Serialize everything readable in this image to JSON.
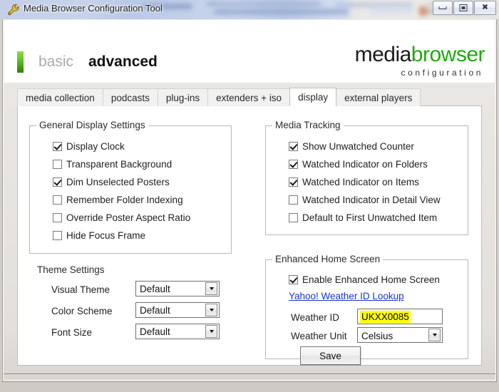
{
  "window": {
    "title": "Media Browser Configuration Tool",
    "icon": "wrench-icon",
    "buttons": {
      "minimize": "Minimize",
      "maximize": "Restore",
      "close": "Close"
    }
  },
  "header": {
    "basic_label": "basic",
    "advanced_label": "advanced",
    "logo_part1": "media",
    "logo_part2": "browser",
    "logo_subtitle": "configuration",
    "accent_green": "#22a613",
    "accent_bar_green": "#5cb81f"
  },
  "tabs": [
    {
      "label": "media collection",
      "active": false
    },
    {
      "label": "podcasts",
      "active": false
    },
    {
      "label": "plug-ins",
      "active": false
    },
    {
      "label": "extenders + iso",
      "active": false
    },
    {
      "label": "display",
      "active": true
    },
    {
      "label": "external players",
      "active": false
    }
  ],
  "general_display_settings": {
    "title": "General Display Settings",
    "checkboxes": [
      {
        "label": "Display Clock",
        "checked": true
      },
      {
        "label": "Transparent Background",
        "checked": false
      },
      {
        "label": "Dim Unselected Posters",
        "checked": true
      },
      {
        "label": "Remember Folder Indexing",
        "checked": false
      },
      {
        "label": "Override Poster Aspect Ratio",
        "checked": false
      },
      {
        "label": "Hide Focus Frame",
        "checked": false
      }
    ]
  },
  "media_tracking": {
    "title": "Media Tracking",
    "checkboxes": [
      {
        "label": "Show Unwatched Counter",
        "checked": true
      },
      {
        "label": "Watched Indicator on Folders",
        "checked": true
      },
      {
        "label": "Watched Indicator on Items",
        "checked": true
      },
      {
        "label": "Watched Indicator in Detail View",
        "checked": false
      },
      {
        "label": "Default to First Unwatched Item",
        "checked": false
      }
    ]
  },
  "theme_settings": {
    "title": "Theme Settings",
    "fields": [
      {
        "label": "Visual Theme",
        "value": "Default"
      },
      {
        "label": "Color Scheme",
        "value": "Default"
      },
      {
        "label": "Font Size",
        "value": "Default"
      }
    ]
  },
  "enhanced_home_screen": {
    "title": "Enhanced Home Screen",
    "enable_checkbox": {
      "label": "Enable Enhanced Home Screen",
      "checked": true
    },
    "lookup_link": "Yahoo! Weather ID Lookup",
    "weather_id": {
      "label": "Weather ID",
      "value": "UKXX0085",
      "highlight_color": "#ffff00"
    },
    "weather_unit": {
      "label": "Weather Unit",
      "value": "Celsius"
    },
    "save_button": "Save"
  }
}
